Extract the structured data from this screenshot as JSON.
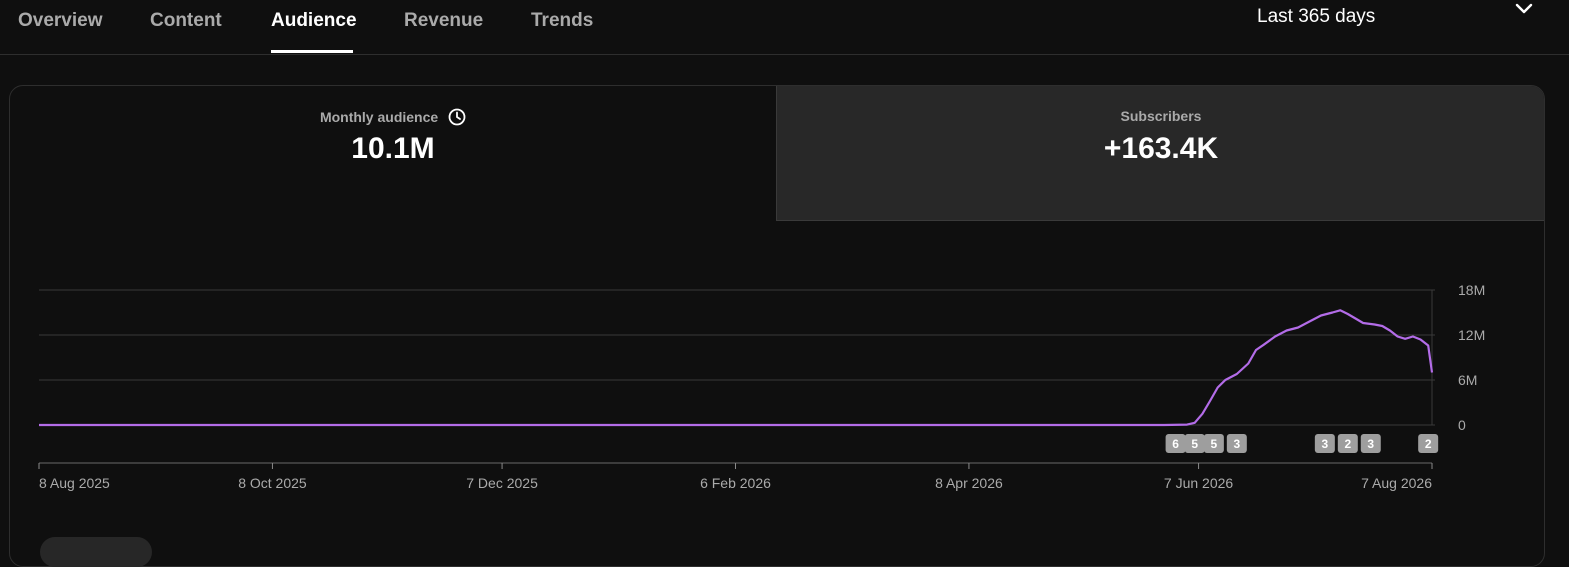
{
  "tabs": [
    {
      "label": "Overview",
      "active": false
    },
    {
      "label": "Content",
      "active": false
    },
    {
      "label": "Audience",
      "active": true
    },
    {
      "label": "Revenue",
      "active": false
    },
    {
      "label": "Trends",
      "active": false
    }
  ],
  "date_range": {
    "label": "Last 365 days",
    "icon": "chevron-down-icon"
  },
  "metrics": [
    {
      "label": "Monthly audience",
      "value": "10.1M",
      "icon": "clock-icon",
      "selected": true
    },
    {
      "label": "Subscribers",
      "value": "+163.4K",
      "selected": false
    }
  ],
  "colors": {
    "line": "#b36ce8",
    "background": "#0f0f0f",
    "selected_tab_bg": "#282828"
  },
  "chart_data": {
    "type": "line",
    "y_ticks": [
      "0",
      "6M",
      "12M",
      "18M"
    ],
    "y_max_millions": 18,
    "x_ticks": [
      "8 Aug 2025",
      "8 Oct 2025",
      "7 Dec 2025",
      "6 Feb 2026",
      "8 Apr 2026",
      "7 Jun 2026",
      "7 Aug 2026"
    ],
    "x_range": [
      "2025-08-08",
      "2026-08-07"
    ],
    "series": [
      {
        "points": [
          [
            "2025-08-08",
            0
          ],
          [
            "2026-05-29",
            0
          ],
          [
            "2026-06-04",
            0.05
          ],
          [
            "2026-06-06",
            0.3
          ],
          [
            "2026-06-08",
            1.5
          ],
          [
            "2026-06-10",
            3.2
          ],
          [
            "2026-06-12",
            5.0
          ],
          [
            "2026-06-14",
            6.0
          ],
          [
            "2026-06-17",
            6.8
          ],
          [
            "2026-06-20",
            8.2
          ],
          [
            "2026-06-22",
            10.0
          ],
          [
            "2026-06-24",
            10.7
          ],
          [
            "2026-06-27",
            11.8
          ],
          [
            "2026-06-30",
            12.6
          ],
          [
            "2026-07-03",
            13.0
          ],
          [
            "2026-07-06",
            13.8
          ],
          [
            "2026-07-09",
            14.6
          ],
          [
            "2026-07-12",
            15.0
          ],
          [
            "2026-07-14",
            15.3
          ],
          [
            "2026-07-16",
            14.8
          ],
          [
            "2026-07-18",
            14.2
          ],
          [
            "2026-07-20",
            13.6
          ],
          [
            "2026-07-23",
            13.4
          ],
          [
            "2026-07-25",
            13.2
          ],
          [
            "2026-07-27",
            12.6
          ],
          [
            "2026-07-29",
            11.8
          ],
          [
            "2026-07-31",
            11.5
          ],
          [
            "2026-08-02",
            11.8
          ],
          [
            "2026-08-04",
            11.4
          ],
          [
            "2026-08-06",
            10.6
          ],
          [
            "2026-08-07",
            7.0
          ]
        ]
      }
    ],
    "markers": [
      {
        "date": "2026-06-01",
        "label": "6"
      },
      {
        "date": "2026-06-06",
        "label": "5"
      },
      {
        "date": "2026-06-11",
        "label": "5"
      },
      {
        "date": "2026-06-17",
        "label": "3"
      },
      {
        "date": "2026-07-10",
        "label": "3"
      },
      {
        "date": "2026-07-16",
        "label": "2"
      },
      {
        "date": "2026-07-22",
        "label": "3"
      },
      {
        "date": "2026-08-06",
        "label": "2"
      }
    ],
    "grid": true
  }
}
